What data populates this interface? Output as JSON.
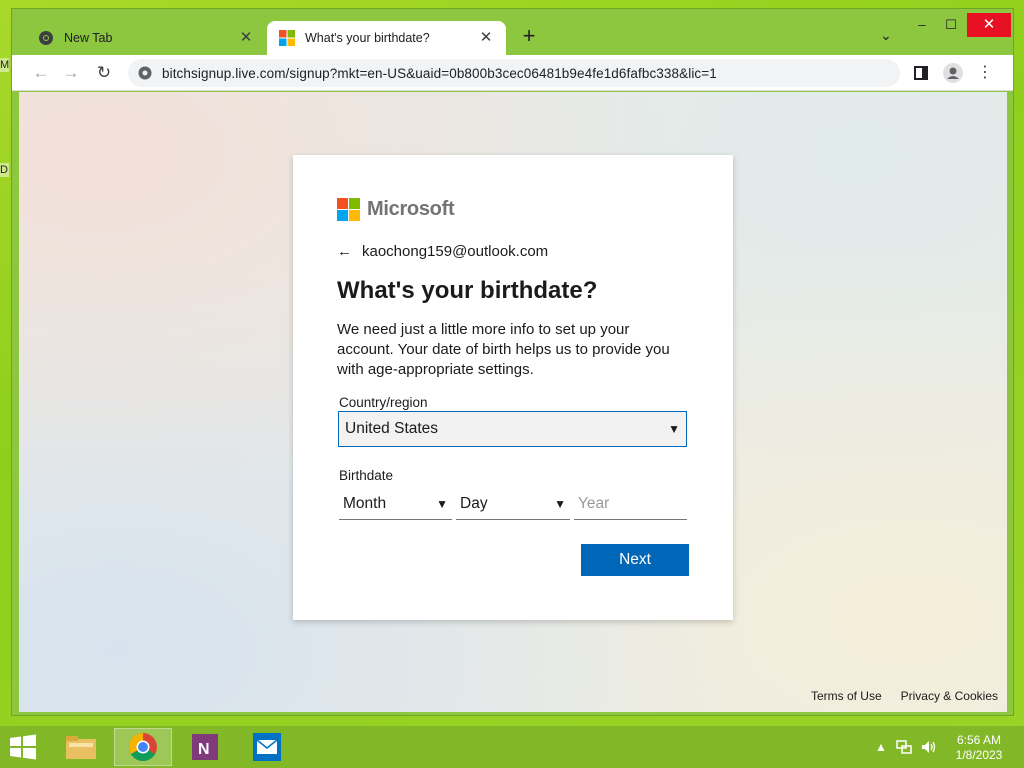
{
  "desktop": {
    "glyph_top": "M",
    "glyph_mid": "D"
  },
  "browser": {
    "tabs": [
      {
        "title": "New Tab",
        "icon": "chrome-icon",
        "active": false
      },
      {
        "title": "What's your birthdate?",
        "icon": "microsoft-icon",
        "active": true
      }
    ],
    "new_tab_symbol": "+",
    "tab_search_symbol": "⌄",
    "window_controls": {
      "minimize": "–",
      "maximize": "☐",
      "close": "✕"
    },
    "nav": {
      "back": "←",
      "forward": "→",
      "reload": "↻"
    },
    "url": "bitchsignup.live.com/signup?mkt=en-US&uaid=0b800b3cec06481b9e4fe1d6fafbc338&lic=1",
    "toolbar_menu": "⋮"
  },
  "signup": {
    "brand": "Microsoft",
    "brand_colors": [
      "#f25022",
      "#7fba00",
      "#00a4ef",
      "#ffb900"
    ],
    "identity": "kaochong159@outlook.com",
    "heading": "What's your birthdate?",
    "description": "We need just a little more info to set up your account. Your date of birth helps us to provide you with age-appropriate settings.",
    "country_label": "Country/region",
    "country_value": "United States",
    "birthdate_label": "Birthdate",
    "month_value": "Month",
    "day_value": "Day",
    "year_placeholder": "Year",
    "next_label": "Next",
    "accent": "#0067b8"
  },
  "footer": {
    "terms": "Terms of Use",
    "privacy": "Privacy & Cookies"
  },
  "taskbar": {
    "apps": [
      "file-explorer-icon",
      "chrome-icon",
      "onenote-icon",
      "mail-icon"
    ],
    "active_app": "chrome-icon",
    "clock_time": "6:56 AM",
    "clock_date": "1/8/2023"
  }
}
